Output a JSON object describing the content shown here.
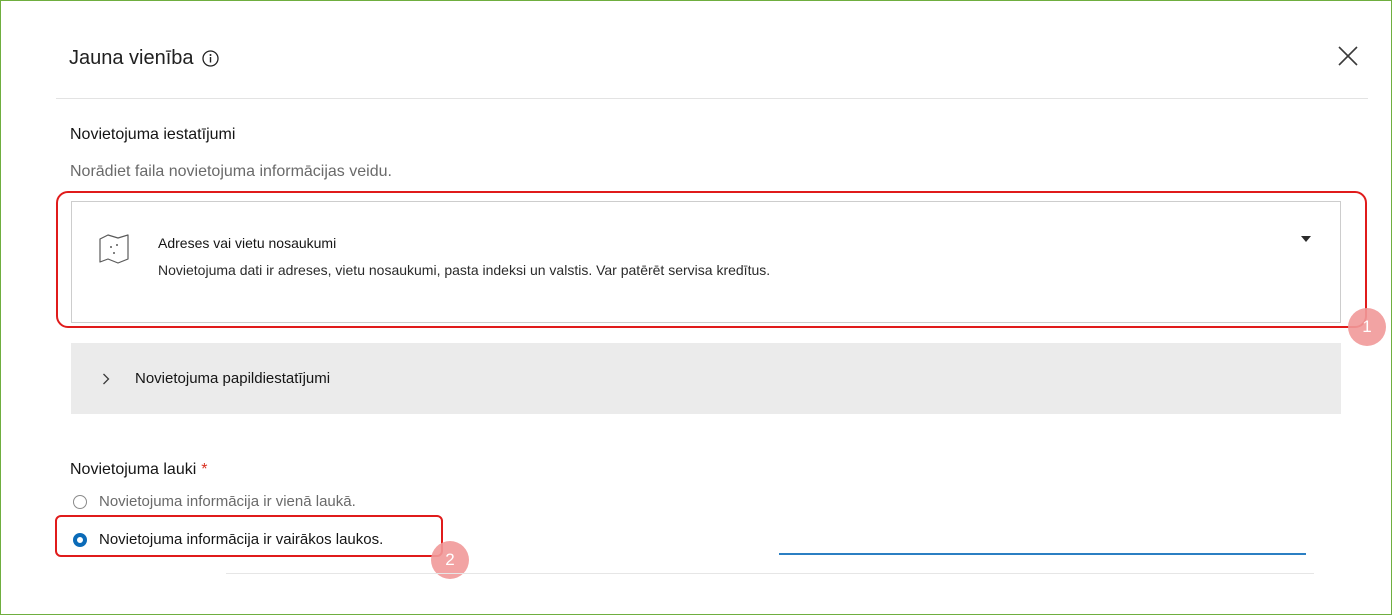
{
  "dialog": {
    "title": "Jauna vienība",
    "close_icon": "close-icon",
    "info_icon": "info-icon"
  },
  "location_settings": {
    "heading": "Novietojuma iestatījumi",
    "description": "Norādiet faila novietojuma informācijas veidu.",
    "selected_option": {
      "icon": "map-icon",
      "title": "Adreses vai vietu nosaukumi",
      "description": "Novietojuma dati ir adreses, vietu nosaukumi, pasta indeksi un valstis. Var patērēt servisa kredītus."
    },
    "advanced": {
      "label": "Novietojuma papildiestatījumi",
      "expanded": false
    }
  },
  "location_fields": {
    "heading": "Novietojuma lauki",
    "required_mark": "*",
    "options": [
      {
        "label": "Novietojuma informācija ir vienā laukā.",
        "selected": false
      },
      {
        "label": "Novietojuma informācija ir vairākos laukos.",
        "selected": true
      }
    ]
  },
  "annotations": {
    "badge1": "1",
    "badge2": "2",
    "highlight_color": "#e01b1b",
    "badge_color": "#f19a9a"
  },
  "colors": {
    "accent": "#0b6bb8",
    "frame_border": "#6fae3f"
  }
}
